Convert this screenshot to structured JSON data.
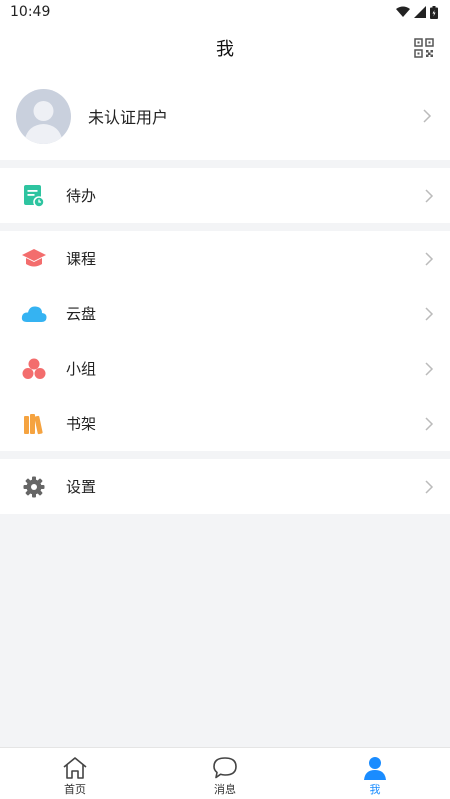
{
  "status_bar": {
    "time": "10:49",
    "icons": [
      "wifi-icon",
      "signal-icon",
      "battery-icon"
    ]
  },
  "header": {
    "title": "我",
    "qr_icon": "qr-code-icon"
  },
  "profile": {
    "name": "未认证用户"
  },
  "menu_groups": [
    [
      {
        "id": "todo",
        "label": "待办",
        "icon": "todo-icon",
        "color": "#2ec4a0"
      }
    ],
    [
      {
        "id": "courses",
        "label": "课程",
        "icon": "course-icon",
        "color": "#f36d6d"
      },
      {
        "id": "cloud",
        "label": "云盘",
        "icon": "cloud-icon",
        "color": "#35b3f2"
      },
      {
        "id": "groups",
        "label": "小组",
        "icon": "group-icon",
        "color": "#f36d6d"
      },
      {
        "id": "bookshelf",
        "label": "书架",
        "icon": "bookshelf-icon",
        "color": "#f5a340"
      }
    ],
    [
      {
        "id": "settings",
        "label": "设置",
        "icon": "gear-icon",
        "color": "#666666"
      }
    ]
  ],
  "tabbar": {
    "tabs": [
      {
        "label": "首页",
        "icon": "home-icon"
      },
      {
        "label": "消息",
        "icon": "message-icon"
      },
      {
        "label": "我",
        "icon": "profile-icon",
        "active": true
      }
    ],
    "active_color": "#1a8cff"
  }
}
